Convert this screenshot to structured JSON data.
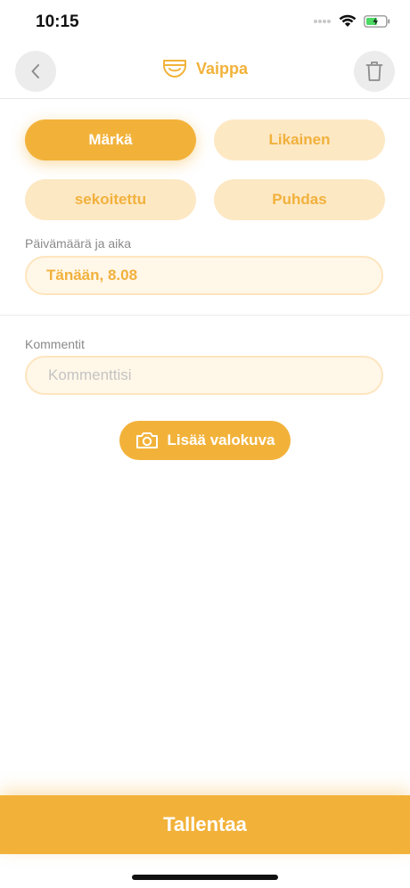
{
  "status_bar": {
    "time": "10:15"
  },
  "nav": {
    "title": "Vaippa",
    "back_icon": "chevron-left-icon",
    "delete_icon": "trash-icon",
    "title_icon": "diaper-icon"
  },
  "types": [
    {
      "label": "Märkä",
      "selected": true
    },
    {
      "label": "Likainen",
      "selected": false
    },
    {
      "label": "sekoitettu",
      "selected": false
    },
    {
      "label": "Puhdas",
      "selected": false
    }
  ],
  "datetime": {
    "label": "Päivämäärä ja aika",
    "value": "Tänään, 8.08"
  },
  "comments": {
    "label": "Kommentit",
    "placeholder": "Kommenttisi",
    "value": ""
  },
  "photo_button": {
    "label": "Lisää valokuva",
    "icon": "camera-icon"
  },
  "save_button": {
    "label": "Tallentaa"
  },
  "colors": {
    "accent": "#f2b23a",
    "accent_light": "#fde8c4",
    "field_bg": "#fff7e8"
  }
}
